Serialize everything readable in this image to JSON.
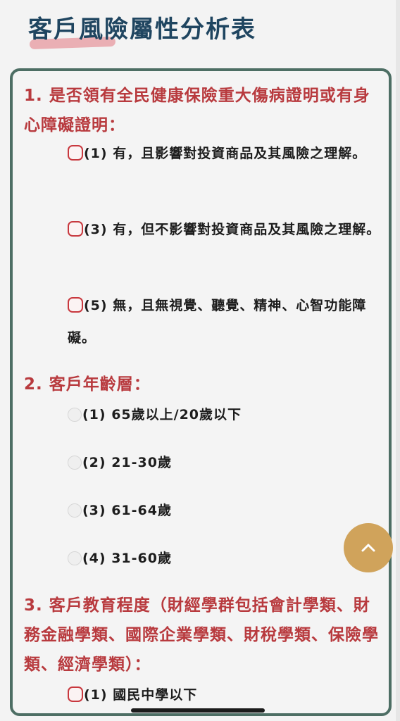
{
  "page_title": "客戶風險屬性分析表",
  "questions": [
    {
      "label": "1. 是否領有全民健康保險重大傷病證明或有身心障礙證明：",
      "options": [
        "(1) 有，且影響對投資商品及其風險之理解。",
        "(3) 有，但不影響對投資商品及其風險之理解。",
        "(5) 無，且無視覺、聽覺、精神、心智功能障礙。"
      ]
    },
    {
      "label": "2. 客戶年齡層：",
      "options": [
        "(1) 65歲以上/20歲以下",
        "(2) 21-30歲",
        "(3) 61-64歲",
        "(4) 31-60歲"
      ]
    },
    {
      "label": "3. 客戶教育程度（財經學群包括會計學類、財務金融學類、國際企業學類、財稅學類、保險學類、經濟學類）：",
      "options": [
        "(1) 國民中學以下"
      ]
    }
  ],
  "scroll_top_icon": "chevron-up-icon",
  "colors": {
    "title": "#1f4560",
    "question": "#b83a3e",
    "card_border": "#4d6e64",
    "scroll_button": "#d0a35b"
  }
}
